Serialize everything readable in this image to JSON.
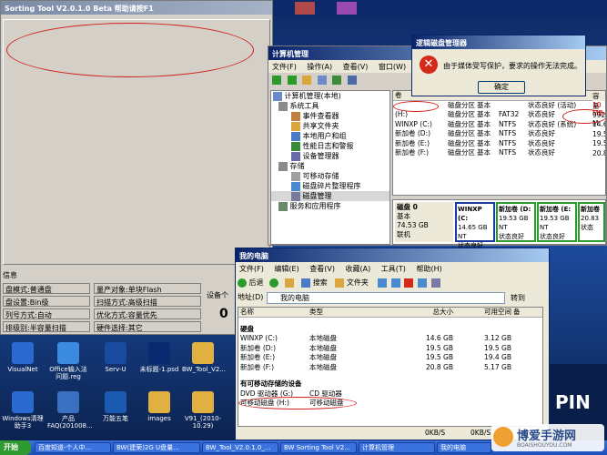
{
  "sort_tool": {
    "title": "Sorting Tool V2.0.1.0 Beta",
    "title_suffix": "帮助请按F1",
    "info_label": "信息",
    "fields": [
      "盘模式:普通盘",
      "盘设置:Bin级",
      "列号方式:自动",
      "排级别:半容量扫描",
      "量产对象:单块Flash",
      "扫描方式:高级扫描",
      "优化方式:容量优先",
      "硬件选择:其它"
    ],
    "device_label": "设备个",
    "device_count": "0"
  },
  "computer_mgmt": {
    "title": "计算机管理",
    "menu": [
      "文件(F)",
      "操作(A)",
      "查看(V)",
      "窗口(W)"
    ],
    "tree": [
      "计算机管理(本地)",
      "系统工具",
      "事件查看器",
      "共享文件夹",
      "本地用户和组",
      "性能日志和警报",
      "设备管理器",
      "存储",
      "可移动存储",
      "磁盘碎片整理程序",
      "磁盘管理",
      "服务和应用程序"
    ],
    "col_header": "卷",
    "volumes": [
      [
        "",
        "磁盘分区",
        "基本",
        "",
        "状态良好 (活动)"
      ],
      [
        "(H:)",
        "磁盘分区",
        "基本",
        "FAT32",
        "状态良好"
      ],
      [
        "WINXP (C:)",
        "磁盘分区",
        "基本",
        "NTFS",
        "状态良好 (系统)"
      ],
      [
        "新加卷 (D:)",
        "磁盘分区",
        "基本",
        "NTFS",
        "状态良好"
      ],
      [
        "新加卷 (E:)",
        "磁盘分区",
        "基本",
        "NTFS",
        "状态良好"
      ],
      [
        "新加卷 (F:)",
        "磁盘分区",
        "基本",
        "NTFS",
        "状态良好"
      ]
    ],
    "right_cut": [
      "容量",
      "10 MB",
      "992 M",
      "14.65",
      "19.53",
      "19.53",
      "20.83"
    ],
    "disk0": {
      "name": "磁盘 0",
      "type": "基本",
      "size": "74.53 GB",
      "state": "联机"
    },
    "partitions": [
      [
        "WINXP (C:",
        "14.65 GB NT",
        "状态良好 (系"
      ],
      [
        "新加卷 (D:",
        "19.53 GB NT",
        "状态良好"
      ],
      [
        "新加卷 (E:",
        "19.53 GB NT",
        "状态良好"
      ],
      [
        "新加卷",
        "20.83",
        "状态"
      ]
    ]
  },
  "error_dialog": {
    "title": "逻辑磁盘管理器",
    "message": "由于媒体受写保护，要求的操作无法完成。",
    "ok": "确定"
  },
  "my_computer": {
    "title": "我的电脑",
    "menu": [
      "文件(F)",
      "编辑(E)",
      "查看(V)",
      "收藏(A)",
      "工具(T)",
      "帮助(H)"
    ],
    "back": "后退",
    "search": "搜索",
    "folders": "文件夹",
    "address_label": "地址(D)",
    "address_value": "我的电脑",
    "go": "转到",
    "headers": [
      "名称",
      "类型",
      "总大小",
      "可用空间",
      "备"
    ],
    "hdd_group": "硬盘",
    "drives": [
      [
        "WINXP (C:)",
        "本地磁盘",
        "14.6 GB",
        "3.12 GB"
      ],
      [
        "新加卷 (D:)",
        "本地磁盘",
        "19.5 GB",
        "19.5 GB"
      ],
      [
        "新加卷 (E:)",
        "本地磁盘",
        "19.5 GB",
        "19.4 GB"
      ],
      [
        "新加卷 (F:)",
        "本地磁盘",
        "20.8 GB",
        "5.17 GB"
      ]
    ],
    "removable_group": "有可移动存储的设备",
    "removable": [
      [
        "DVD 驱动器 (G:)",
        "CD 驱动器"
      ],
      [
        "可移动磁盘 (H:)",
        "可移动磁盘"
      ]
    ],
    "status": [
      "0KB/S",
      "0KB/S"
    ]
  },
  "desktop_icons": [
    "VisualNet",
    "Office输入法问题.reg",
    "Serv-U",
    "未标题-1.psd",
    "BW_Tool_V2...",
    "Windows清理助手3",
    "产品FAQ(201008...",
    "万能五笔",
    "images",
    "V91_(2010-10.29)"
  ],
  "taskbar": {
    "start": "开始",
    "tasks": [
      "百度知道-个人中...",
      "BW(建荣)2G U盘量...",
      "BW_Tool_V2.0.1.0_...",
      "BW Sorting Tool V2...",
      "计算机管理",
      "我的电脑"
    ]
  },
  "watermark": {
    "text": "博爱手游网",
    "sub": "BOAISHOUYOU.COM"
  },
  "splash_text": "PIN"
}
